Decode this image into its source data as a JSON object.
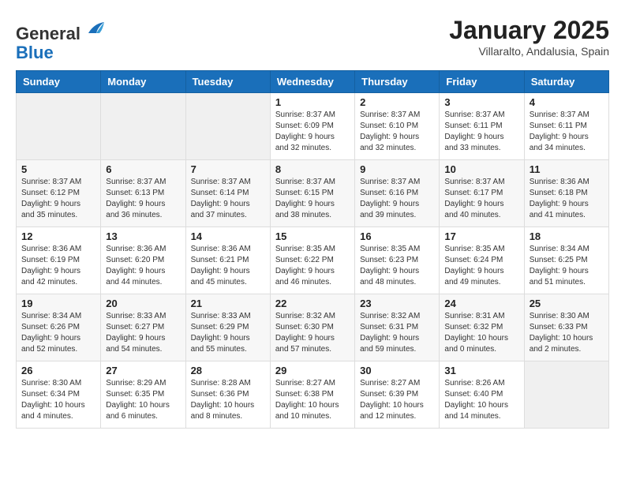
{
  "header": {
    "logo_line1": "General",
    "logo_line2": "Blue",
    "month_title": "January 2025",
    "location": "Villaralto, Andalusia, Spain"
  },
  "weekdays": [
    "Sunday",
    "Monday",
    "Tuesday",
    "Wednesday",
    "Thursday",
    "Friday",
    "Saturday"
  ],
  "weeks": [
    [
      {
        "day": "",
        "info": ""
      },
      {
        "day": "",
        "info": ""
      },
      {
        "day": "",
        "info": ""
      },
      {
        "day": "1",
        "info": "Sunrise: 8:37 AM\nSunset: 6:09 PM\nDaylight: 9 hours\nand 32 minutes."
      },
      {
        "day": "2",
        "info": "Sunrise: 8:37 AM\nSunset: 6:10 PM\nDaylight: 9 hours\nand 32 minutes."
      },
      {
        "day": "3",
        "info": "Sunrise: 8:37 AM\nSunset: 6:11 PM\nDaylight: 9 hours\nand 33 minutes."
      },
      {
        "day": "4",
        "info": "Sunrise: 8:37 AM\nSunset: 6:11 PM\nDaylight: 9 hours\nand 34 minutes."
      }
    ],
    [
      {
        "day": "5",
        "info": "Sunrise: 8:37 AM\nSunset: 6:12 PM\nDaylight: 9 hours\nand 35 minutes."
      },
      {
        "day": "6",
        "info": "Sunrise: 8:37 AM\nSunset: 6:13 PM\nDaylight: 9 hours\nand 36 minutes."
      },
      {
        "day": "7",
        "info": "Sunrise: 8:37 AM\nSunset: 6:14 PM\nDaylight: 9 hours\nand 37 minutes."
      },
      {
        "day": "8",
        "info": "Sunrise: 8:37 AM\nSunset: 6:15 PM\nDaylight: 9 hours\nand 38 minutes."
      },
      {
        "day": "9",
        "info": "Sunrise: 8:37 AM\nSunset: 6:16 PM\nDaylight: 9 hours\nand 39 minutes."
      },
      {
        "day": "10",
        "info": "Sunrise: 8:37 AM\nSunset: 6:17 PM\nDaylight: 9 hours\nand 40 minutes."
      },
      {
        "day": "11",
        "info": "Sunrise: 8:36 AM\nSunset: 6:18 PM\nDaylight: 9 hours\nand 41 minutes."
      }
    ],
    [
      {
        "day": "12",
        "info": "Sunrise: 8:36 AM\nSunset: 6:19 PM\nDaylight: 9 hours\nand 42 minutes."
      },
      {
        "day": "13",
        "info": "Sunrise: 8:36 AM\nSunset: 6:20 PM\nDaylight: 9 hours\nand 44 minutes."
      },
      {
        "day": "14",
        "info": "Sunrise: 8:36 AM\nSunset: 6:21 PM\nDaylight: 9 hours\nand 45 minutes."
      },
      {
        "day": "15",
        "info": "Sunrise: 8:35 AM\nSunset: 6:22 PM\nDaylight: 9 hours\nand 46 minutes."
      },
      {
        "day": "16",
        "info": "Sunrise: 8:35 AM\nSunset: 6:23 PM\nDaylight: 9 hours\nand 48 minutes."
      },
      {
        "day": "17",
        "info": "Sunrise: 8:35 AM\nSunset: 6:24 PM\nDaylight: 9 hours\nand 49 minutes."
      },
      {
        "day": "18",
        "info": "Sunrise: 8:34 AM\nSunset: 6:25 PM\nDaylight: 9 hours\nand 51 minutes."
      }
    ],
    [
      {
        "day": "19",
        "info": "Sunrise: 8:34 AM\nSunset: 6:26 PM\nDaylight: 9 hours\nand 52 minutes."
      },
      {
        "day": "20",
        "info": "Sunrise: 8:33 AM\nSunset: 6:27 PM\nDaylight: 9 hours\nand 54 minutes."
      },
      {
        "day": "21",
        "info": "Sunrise: 8:33 AM\nSunset: 6:29 PM\nDaylight: 9 hours\nand 55 minutes."
      },
      {
        "day": "22",
        "info": "Sunrise: 8:32 AM\nSunset: 6:30 PM\nDaylight: 9 hours\nand 57 minutes."
      },
      {
        "day": "23",
        "info": "Sunrise: 8:32 AM\nSunset: 6:31 PM\nDaylight: 9 hours\nand 59 minutes."
      },
      {
        "day": "24",
        "info": "Sunrise: 8:31 AM\nSunset: 6:32 PM\nDaylight: 10 hours\nand 0 minutes."
      },
      {
        "day": "25",
        "info": "Sunrise: 8:30 AM\nSunset: 6:33 PM\nDaylight: 10 hours\nand 2 minutes."
      }
    ],
    [
      {
        "day": "26",
        "info": "Sunrise: 8:30 AM\nSunset: 6:34 PM\nDaylight: 10 hours\nand 4 minutes."
      },
      {
        "day": "27",
        "info": "Sunrise: 8:29 AM\nSunset: 6:35 PM\nDaylight: 10 hours\nand 6 minutes."
      },
      {
        "day": "28",
        "info": "Sunrise: 8:28 AM\nSunset: 6:36 PM\nDaylight: 10 hours\nand 8 minutes."
      },
      {
        "day": "29",
        "info": "Sunrise: 8:27 AM\nSunset: 6:38 PM\nDaylight: 10 hours\nand 10 minutes."
      },
      {
        "day": "30",
        "info": "Sunrise: 8:27 AM\nSunset: 6:39 PM\nDaylight: 10 hours\nand 12 minutes."
      },
      {
        "day": "31",
        "info": "Sunrise: 8:26 AM\nSunset: 6:40 PM\nDaylight: 10 hours\nand 14 minutes."
      },
      {
        "day": "",
        "info": ""
      }
    ]
  ]
}
